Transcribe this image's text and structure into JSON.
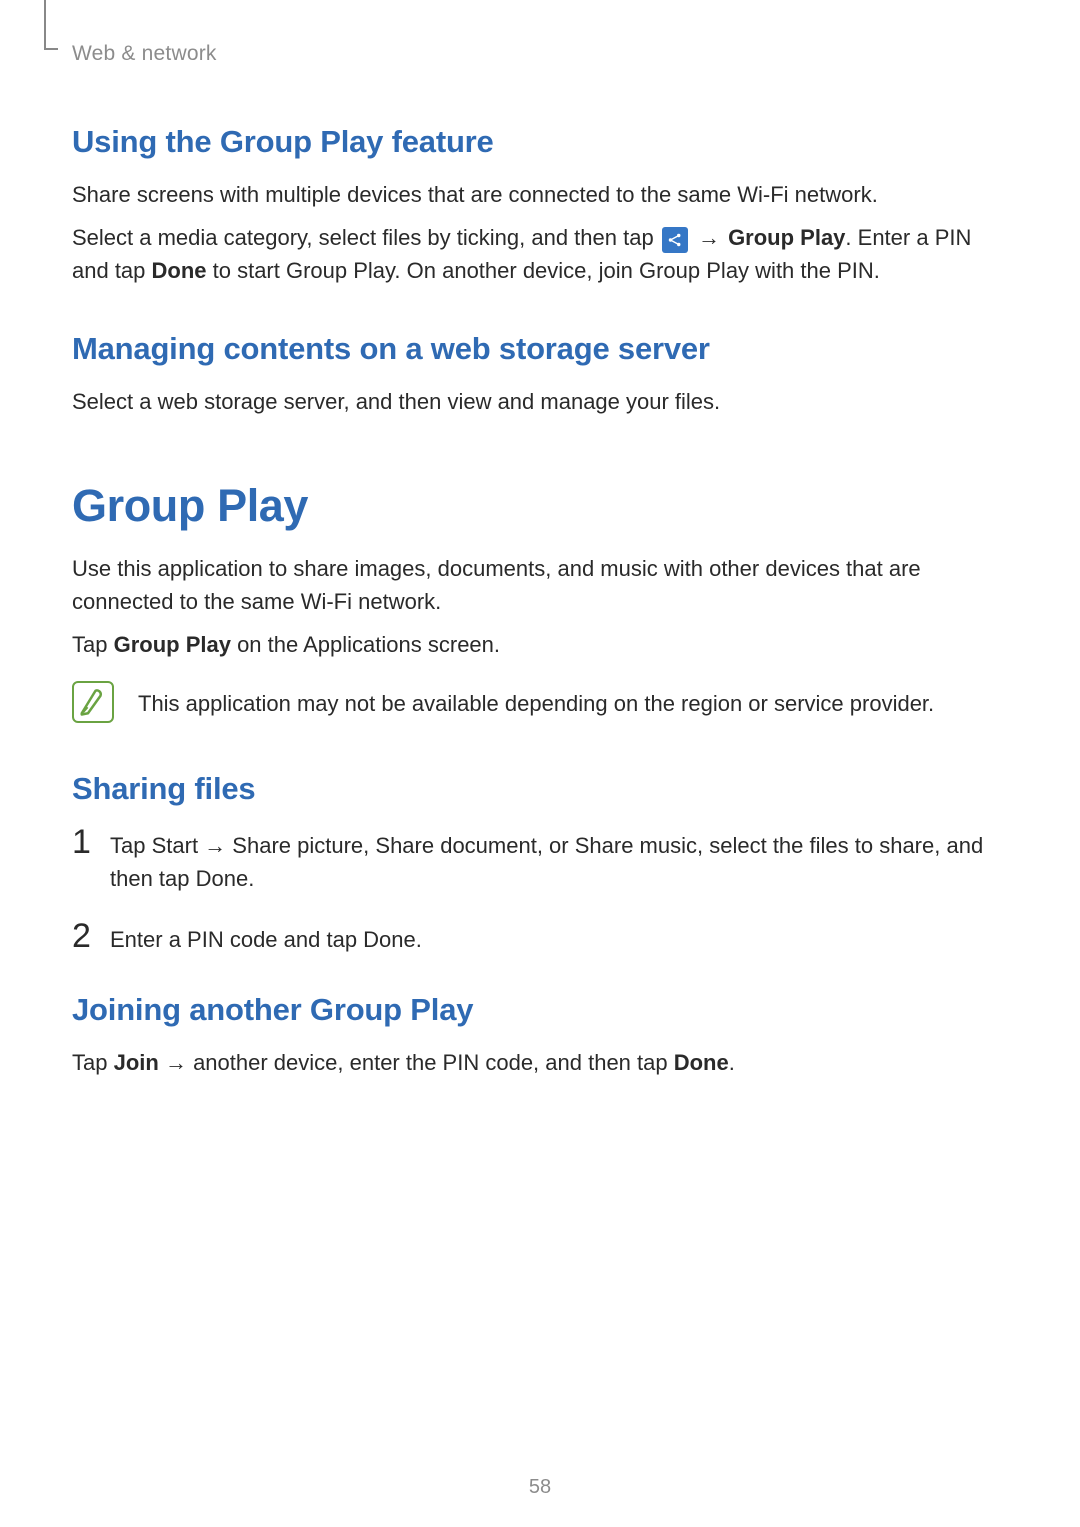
{
  "header": {
    "section": "Web & network"
  },
  "section1": {
    "title": "Using the Group Play feature",
    "p1": "Share screens with multiple devices that are connected to the same Wi-Fi network.",
    "p2_pre": "Select a media category, select files by ticking, and then tap ",
    "p2_arrow": "→",
    "p2_bold1": "Group Play",
    "p2_mid": ". Enter a PIN and tap ",
    "p2_bold2": "Done",
    "p2_post": " to start Group Play. On another device, join Group Play with the PIN."
  },
  "section2": {
    "title": "Managing contents on a web storage server",
    "p1": "Select a web storage server, and then view and manage your files."
  },
  "section3": {
    "title": "Group Play",
    "p1": "Use this application to share images, documents, and music with other devices that are connected to the same Wi-Fi network.",
    "p2_pre": "Tap ",
    "p2_bold": "Group Play",
    "p2_post": " on the Applications screen.",
    "note": "This application may not be available depending on the region or service provider."
  },
  "section4": {
    "title": "Sharing files",
    "step1": {
      "num": "1",
      "pre": "Tap ",
      "b1": "Start",
      "arrow1": " → ",
      "b2": "Share picture",
      "sep1": ", ",
      "b3": "Share document",
      "sep2": ", or ",
      "b4": "Share music",
      "mid": ", select the files to share, and then tap ",
      "b5": "Done",
      "post": "."
    },
    "step2": {
      "num": "2",
      "pre": "Enter a PIN code and tap ",
      "b1": "Done",
      "post": "."
    }
  },
  "section5": {
    "title": "Joining another Group Play",
    "p1_pre": "Tap ",
    "p1_b1": "Join",
    "p1_arrow": " → ",
    "p1_mid": "another device, enter the PIN code, and then tap ",
    "p1_b2": "Done",
    "p1_post": "."
  },
  "page_number": "58"
}
